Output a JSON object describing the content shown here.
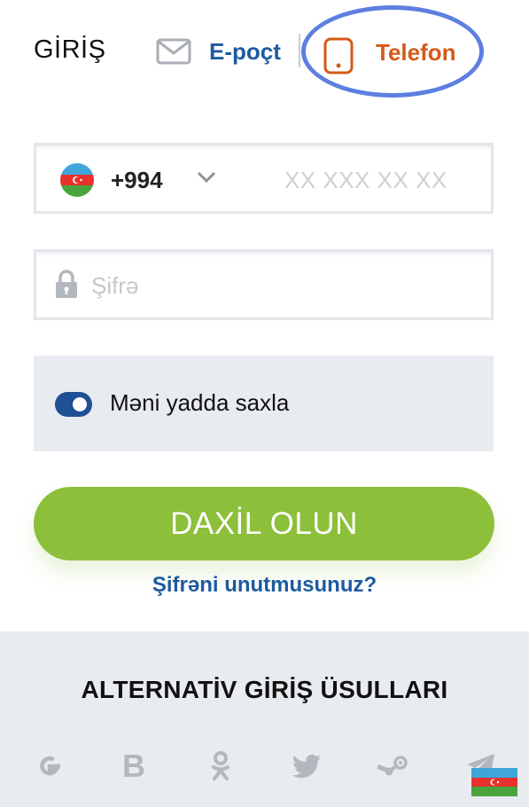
{
  "header": {
    "title": "GİRİŞ",
    "tabs": {
      "email_label": "E-poçt",
      "phone_label": "Telefon"
    }
  },
  "form": {
    "phone": {
      "country_code": "+994",
      "placeholder": "XX XXX XX XX",
      "flag_icon": "azerbaijan-flag-icon"
    },
    "password": {
      "placeholder": "Şifrə"
    },
    "remember": {
      "label": "Məni yadda saxla",
      "checked": true
    }
  },
  "actions": {
    "login_label": "DAXİL OLUN",
    "forgot_label": "Şifrəni unutmusunuz?"
  },
  "alternative": {
    "title": "ALTERNATİV GİRİŞ ÜSULLARI",
    "providers": [
      "google-icon",
      "bookmaker-b-icon",
      "odnoklassniki-icon",
      "twitter-icon",
      "steam-icon",
      "telegram-icon"
    ]
  },
  "colors": {
    "brand_blue": "#1e5aa0",
    "accent_orange": "#d45a1a",
    "button_green": "#8cbf3a",
    "toggle_blue": "#1f4f94"
  }
}
